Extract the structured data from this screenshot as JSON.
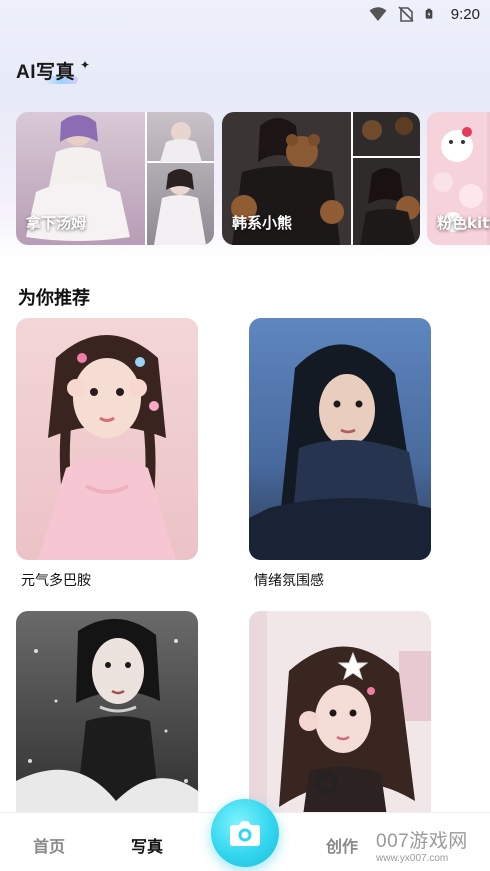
{
  "status_bar": {
    "time": "9:20"
  },
  "header": {
    "title": "AI写真",
    "sparkle": "✦"
  },
  "styles": [
    {
      "label": "拿下汤姆"
    },
    {
      "label": "韩系小熊"
    },
    {
      "label": "粉色kitty"
    }
  ],
  "recommend": {
    "title": "为你推荐",
    "items": [
      {
        "label": "元气多巴胺"
      },
      {
        "label": "情绪氛围感"
      },
      {
        "label": ""
      },
      {
        "label": ""
      }
    ]
  },
  "bottom_nav": {
    "home": "首页",
    "photo": "写真",
    "create": "创作"
  },
  "watermark": {
    "brand": "007游戏网",
    "url": "www.yx007.com"
  },
  "colors": {
    "accent": "#33d6ee",
    "text": "#111111",
    "muted": "#888888"
  }
}
